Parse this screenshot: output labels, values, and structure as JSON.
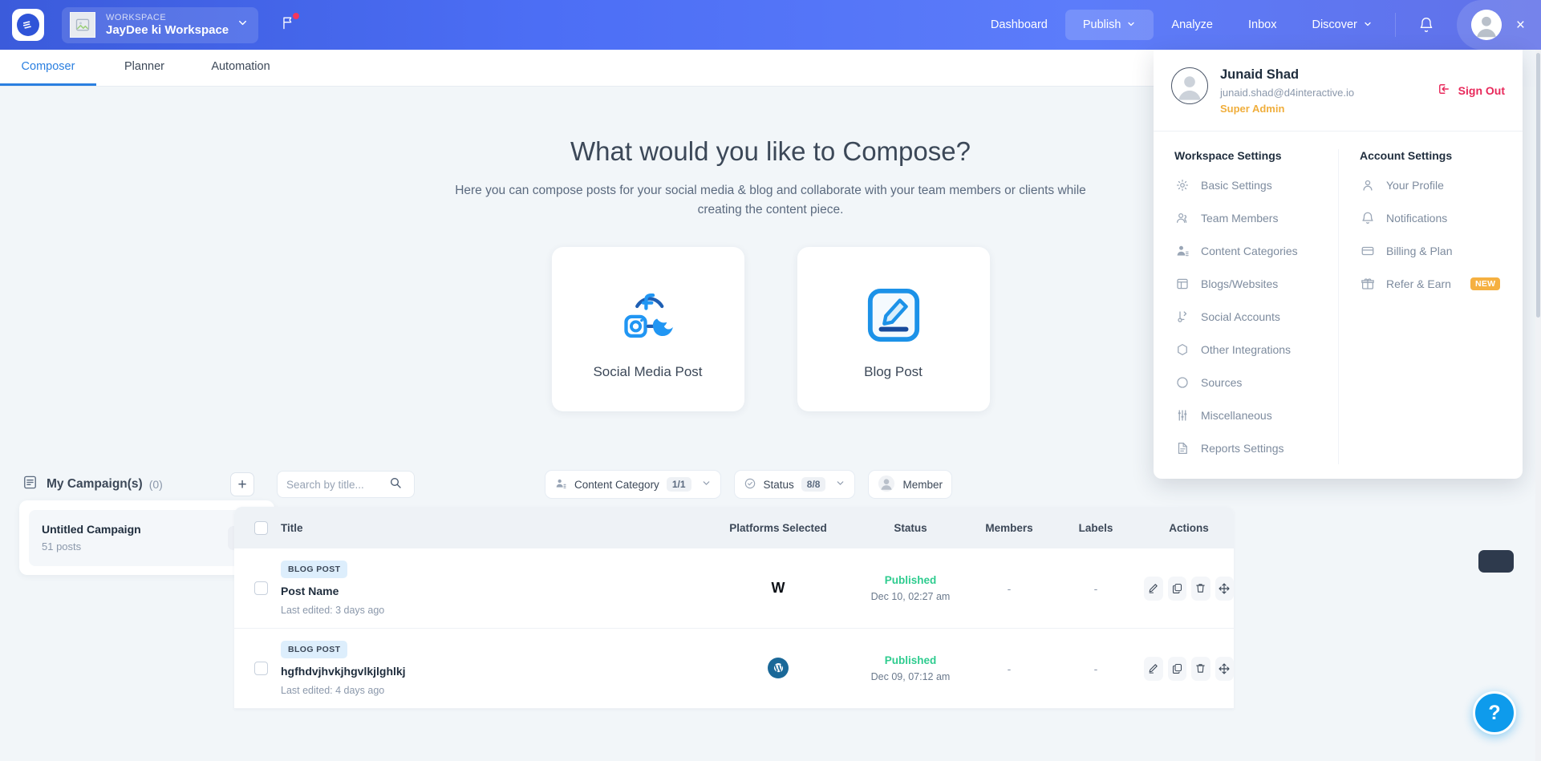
{
  "topnav": {
    "workspace_label": "WORKSPACE",
    "workspace_name": "JayDee ki Workspace",
    "logo_icon": "contentstudio-logo-icon",
    "flag_icon": "flag-icon",
    "links": [
      {
        "label": "Dashboard",
        "icon": "",
        "caret": false,
        "active": false
      },
      {
        "label": "Publish",
        "icon": "",
        "caret": true,
        "active": true
      },
      {
        "label": "Analyze",
        "icon": "",
        "caret": false,
        "active": false
      },
      {
        "label": "Inbox",
        "icon": "",
        "caret": false,
        "active": false
      },
      {
        "label": "Discover",
        "icon": "",
        "caret": true,
        "active": false
      }
    ],
    "bell_icon": "bell-icon",
    "avatar_icon": "user-avatar-icon",
    "close_label": "×"
  },
  "subtabs": [
    {
      "label": "Composer",
      "active": true
    },
    {
      "label": "Planner",
      "active": false
    },
    {
      "label": "Automation",
      "active": false
    }
  ],
  "hero": {
    "title": "What would you like to Compose?",
    "description": "Here you can compose posts for your social media & blog and collaborate with your team members or clients while creating the content piece."
  },
  "compose_cards": [
    {
      "label": "Social Media Post",
      "icon": "social-network-icon"
    },
    {
      "label": "Blog Post",
      "icon": "blog-pencil-icon"
    }
  ],
  "campaigns": {
    "icon": "campaign-list-icon",
    "title": "My Campaign(s)",
    "count": "(0)",
    "add_label": "+",
    "items": [
      {
        "name": "Untitled Campaign",
        "posts": "51 posts",
        "edit_icon": "pencil-icon"
      }
    ]
  },
  "search": {
    "placeholder": "Search by title...",
    "value": "",
    "icon": "search-icon"
  },
  "filters": [
    {
      "label": "Content Category",
      "count": "1/1",
      "icon": "content-category-icon"
    },
    {
      "label": "Status",
      "count": "8/8",
      "icon": "status-check-icon"
    },
    {
      "label": "Member",
      "count": "",
      "icon": "member-avatar-icon"
    }
  ],
  "table": {
    "columns": [
      "Title",
      "Platforms Selected",
      "Status",
      "Members",
      "Labels",
      "Actions"
    ],
    "rows": [
      {
        "badge": "BLOG POST",
        "title": "Post Name",
        "subtitle": "Last edited: 3 days ago",
        "platform_icon": "w-letter-icon",
        "platform_glyph": "W",
        "status": "Published",
        "status_date": "Dec 10, 02:27 am",
        "members": "-",
        "labels": "-",
        "actions": [
          "edit-icon",
          "duplicate-icon",
          "delete-icon",
          "move-icon"
        ]
      },
      {
        "badge": "BLOG POST",
        "title": "hgfhdvjhvkjhgvlkjlghlkj",
        "subtitle": "Last edited: 4 days ago",
        "platform_icon": "wordpress-icon",
        "platform_glyph": "W",
        "status": "Published",
        "status_date": "Dec 09, 07:12 am",
        "members": "-",
        "labels": "-",
        "actions": [
          "edit-icon",
          "duplicate-icon",
          "delete-icon",
          "move-icon"
        ]
      }
    ]
  },
  "user_dropdown": {
    "name": "Junaid Shad",
    "email": "junaid.shad@d4interactive.io",
    "role": "Super Admin",
    "sign_out_label": "Sign Out",
    "sign_out_icon": "sign-out-icon",
    "workspace_settings": {
      "title": "Workspace Settings",
      "items": [
        {
          "label": "Basic Settings",
          "icon": "gear-icon"
        },
        {
          "label": "Team Members",
          "icon": "people-icon"
        },
        {
          "label": "Content Categories",
          "icon": "person-tag-icon"
        },
        {
          "label": "Blogs/Websites",
          "icon": "layout-icon"
        },
        {
          "label": "Social Accounts",
          "icon": "share-icon"
        },
        {
          "label": "Other Integrations",
          "icon": "hexagon-icon"
        },
        {
          "label": "Sources",
          "icon": "circle-icon"
        },
        {
          "label": "Miscellaneous",
          "icon": "sliders-icon"
        },
        {
          "label": "Reports Settings",
          "icon": "document-icon"
        }
      ]
    },
    "account_settings": {
      "title": "Account Settings",
      "items": [
        {
          "label": "Your Profile",
          "icon": "user-icon",
          "badge": ""
        },
        {
          "label": "Notifications",
          "icon": "bell-icon",
          "badge": ""
        },
        {
          "label": "Billing & Plan",
          "icon": "card-icon",
          "badge": ""
        },
        {
          "label": "Refer & Earn",
          "icon": "gift-icon",
          "badge": "NEW"
        }
      ]
    }
  },
  "help": {
    "label": "?",
    "icon": "help-icon"
  },
  "colors": {
    "nav_gradient_start": "#3b5bdb",
    "nav_gradient_end": "#6171e8",
    "accent_blue": "#2a7fe0",
    "published_green": "#2ecc8f",
    "role_orange": "#f0ae3c",
    "signout_red": "#e8295b",
    "help_blue": "#0e9bec",
    "new_badge": "#f5b041"
  }
}
